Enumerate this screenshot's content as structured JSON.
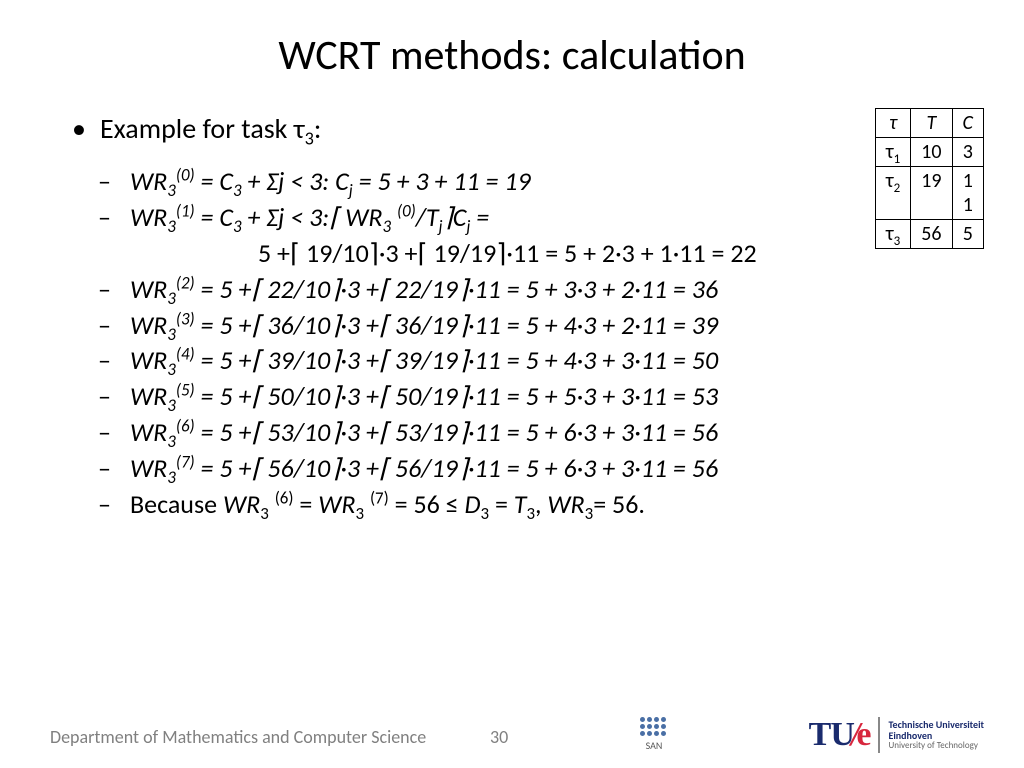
{
  "title": "WCRT methods: calculation",
  "bullet": {
    "pre": "Example for task ",
    "tau": "τ",
    "sub": "3",
    "post": ":"
  },
  "lines": {
    "l0": "WR<sub>3</sub><sup>(0)</sup> = <span class=\"i\">C</span><sub>3</sub> + Σj < 3: <span class=\"i\">C</span><sub>j</sub> = 5 + 3 + 11 = 19",
    "l1a": "WR<sub>3</sub><sup>(1)</sup> = <span class=\"i\">C</span><sub>3</sub> + Σj < 3:⌈ <span class=\"i\">WR</span><sub>3</sub> <sup>(0)</sup>/<span class=\"i\">T</span><sub>j</sub>⌉<span class=\"i\">C</span><sub>j</sub> =",
    "l1b": "5 +⌈ 19/10⌉·3 +⌈ 19/19⌉·11 = 5 + 2·3 + 1·11 = 22",
    "l2": "WR<sub>3</sub><sup>(2)</sup> =  5 +⌈ 22/10⌉·3 +⌈ 22/19⌉·11 = 5 + 3·3 + 2·11 = 36",
    "l3": "WR<sub>3</sub><sup>(3)</sup> =  5 +⌈ 36/10⌉·3 +⌈ 36/19⌉·11 = 5 + 4·3 + 2·11 = 39",
    "l4": "WR<sub>3</sub><sup>(4)</sup> =  5 +⌈ 39/10⌉·3 +⌈ 39/19⌉·11 = 5 + 4·3 + 3·11 = 50",
    "l5": "WR<sub>3</sub><sup>(5)</sup> =  5 +⌈ 50/10⌉·3 +⌈ 50/19⌉·11 = 5 + 5·3 + 3·11 = 53",
    "l6": "WR<sub>3</sub><sup>(6)</sup> =  5 +⌈ 53/10⌉·3 +⌈ 53/19⌉·11 = 5 + 6·3 + 3·11 = 56",
    "l7": "WR<sub>3</sub><sup>(7)</sup> =  5 +⌈ 56/10⌉·3 +⌈ 56/19⌉·11 = 5 + 6·3 + 3·11 = 56",
    "l8": "Because <span class=\"i\">WR</span><sub>3</sub> <sup>(6)</sup> = <span class=\"i\">WR</span><sub>3</sub> <sup>(7)</sup> = 56 ≤ <span class=\"i\">D</span><sub>3</sub> = <span class=\"i\">T</span><sub>3</sub>, <span class=\"i\">WR</span><sub>3</sub>= 56."
  },
  "table": {
    "headers": [
      "τ",
      "T",
      "C"
    ],
    "rows": [
      {
        "tau": "τ",
        "sub": "1",
        "T": "10",
        "C": "3"
      },
      {
        "tau": "τ",
        "sub": "2",
        "T": "19",
        "C": "1\n1"
      },
      {
        "tau": "τ",
        "sub": "3",
        "T": "56",
        "C": "5"
      }
    ]
  },
  "footer": {
    "dept": "Department of Mathematics and Computer Science",
    "page": "30",
    "san": "SAN",
    "tue": {
      "t": "TU",
      "slash": "/",
      "e": "e",
      "l1": "Technische Universiteit",
      "l2": "Eindhoven",
      "l3": "University of Technology"
    }
  }
}
